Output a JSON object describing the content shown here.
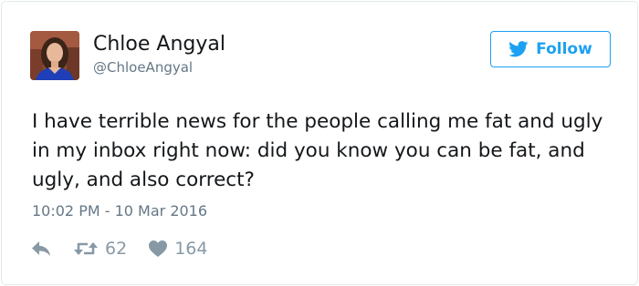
{
  "tweet": {
    "author": {
      "name": "Chloe Angyal",
      "handle": "@ChloeAngyal",
      "avatar_icon": "profile-photo"
    },
    "follow_button": {
      "label": "Follow",
      "icon": "bird-icon",
      "color": "#1da1f2"
    },
    "text": "I have terrible news for the people calling me fat and ugly in my inbox right now: did you know you can be fat, and ugly, and also correct?",
    "timestamp": "10:02 PM - 10 Mar 2016",
    "actions": {
      "reply_icon": "reply-icon",
      "retweet_icon": "retweet-icon",
      "retweet_count": "62",
      "like_icon": "heart-icon",
      "like_count": "164"
    }
  },
  "colors": {
    "text": "#14171a",
    "muted": "#657786",
    "action_gray": "#8899a6",
    "accent": "#1da1f2"
  }
}
